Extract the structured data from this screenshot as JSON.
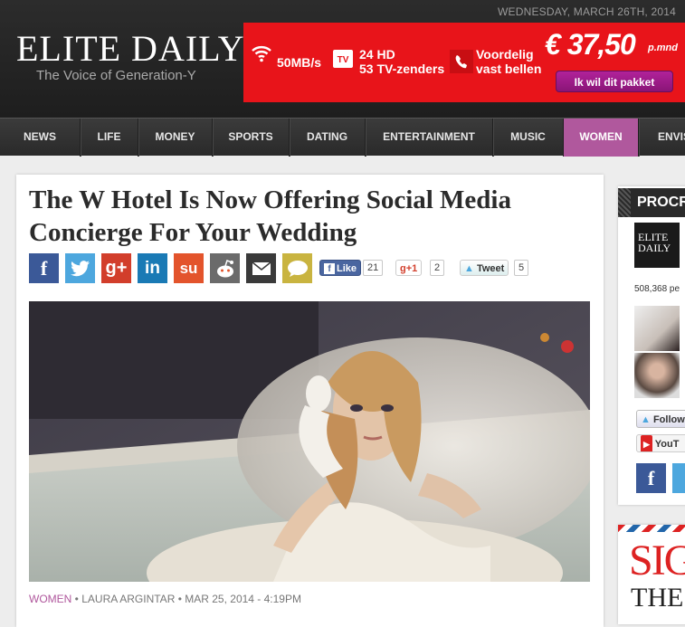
{
  "header": {
    "date": "WEDNESDAY, MARCH 26TH, 2014",
    "logo": "ELITE DAILY",
    "tagline": "The Voice of Generation-Y"
  },
  "ad": {
    "speed": "50MB/s",
    "tv_line1": "24 HD",
    "tv_line2": "53 TV-zenders",
    "call_line1": "Voordelig",
    "call_line2": "vast bellen",
    "price": "€ 37,50",
    "price_suffix": "p.mnd",
    "cta": "Ik wil dit pakket",
    "tv_badge": "TV",
    "colors": {
      "bg": "#e8141a",
      "cta": "#b1229a"
    }
  },
  "nav": {
    "items": [
      "NEWS",
      "LIFE",
      "MONEY",
      "SPORTS",
      "DATING",
      "ENTERTAINMENT",
      "MUSIC",
      "WOMEN",
      "ENVIS"
    ],
    "active": "WOMEN",
    "active_color": "#b0589d"
  },
  "article": {
    "headline": "The W Hotel Is Now Offering Social Media Concierge For Your Wedding",
    "share": {
      "fb_like_label": "Like",
      "fb_like_count": "21",
      "gplus_label": "+1",
      "gplus_count": "2",
      "tweet_label": "Tweet",
      "tweet_count": "5",
      "icons": [
        "facebook-icon",
        "twitter-icon",
        "google-plus-icon",
        "linkedin-icon",
        "stumbleupon-icon",
        "reddit-icon",
        "email-icon",
        "comment-icon"
      ],
      "glyphs": {
        "facebook": "f",
        "gplus": "g+",
        "linkedin": "in",
        "stumbleupon": "su",
        "gplus_small": "g"
      }
    },
    "byline": {
      "category": "WOMEN",
      "author": "LAURA ARGINTAR",
      "date": "MAR 25, 2014 - 4:19PM",
      "separator": "•"
    }
  },
  "sidebar": {
    "heading": "PROCR",
    "logo_line1": "ELITE",
    "logo_line2": "DAILY",
    "followers": "508,368 pe",
    "twitter_follow": "Follow",
    "youtube": "YouT",
    "fb_glyph": "f",
    "promo_big": "SIG",
    "promo_sub": "THE"
  }
}
